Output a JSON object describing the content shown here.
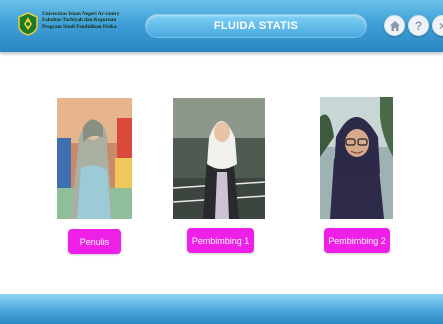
{
  "header": {
    "institution_lines": [
      "Universitas Islam Negeri Ar-raniry",
      "Fakultas Tarbiyah dan Keguruan",
      "Program Studi Pendidikan Fisika"
    ],
    "title": "FLUIDA STATIS",
    "buttons": {
      "home_icon": "home-icon",
      "help_label": "?",
      "close_label": "×"
    }
  },
  "people": [
    {
      "role": "Penulis"
    },
    {
      "role": "Pembimbing 1"
    },
    {
      "role": "Pembimbing 2"
    }
  ],
  "colors": {
    "header_blue": "#3f9fd6",
    "role_button": "#ee1fe6"
  }
}
